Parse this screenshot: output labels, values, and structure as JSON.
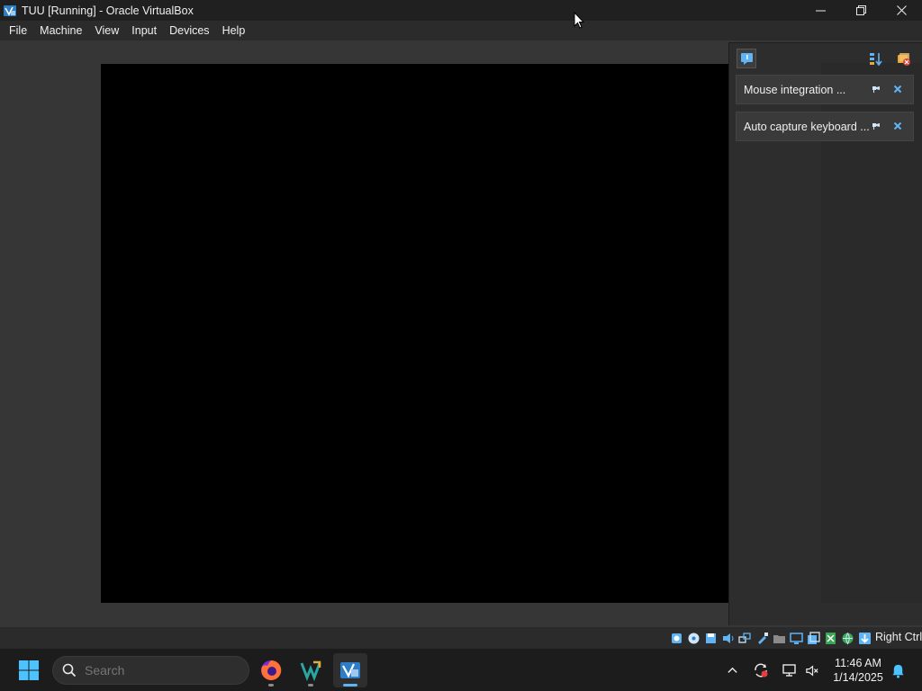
{
  "window": {
    "title": "TUU [Running] - Oracle VirtualBox",
    "controls": [
      "minimize",
      "maximize",
      "close"
    ]
  },
  "menubar": {
    "items": [
      "File",
      "Machine",
      "View",
      "Input",
      "Devices",
      "Help"
    ]
  },
  "notifications": {
    "items": [
      {
        "text": "Mouse integration ..."
      },
      {
        "text": "Auto capture keyboard ..."
      }
    ]
  },
  "statusbar": {
    "host_key": "Right Ctrl"
  },
  "taskbar": {
    "search_placeholder": "Search",
    "apps": [
      "firefox-icon",
      "vscode-icon",
      "virtualbox-icon"
    ],
    "active_app": "virtualbox",
    "time": "11:46 AM",
    "date": "1/14/2025"
  },
  "colors": {
    "accent": "#5fb4f5",
    "titlebar": "#202020",
    "taskbar": "#1c1c1c",
    "vm_screen": "#000000"
  }
}
